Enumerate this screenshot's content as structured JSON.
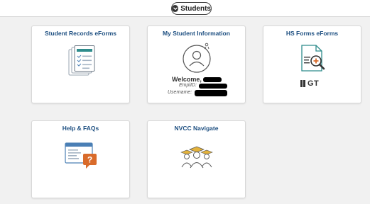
{
  "nav": {
    "current": "Students"
  },
  "tiles": [
    {
      "label": "Student Records eForms",
      "icon": "clipboard-checklist-icon"
    },
    {
      "label": "My Student Information",
      "icon": "student-avatar-icon",
      "welcome_label": "Welcome,",
      "emplid_label": "EmplID:",
      "username_label": "Username:"
    },
    {
      "label": "HS Forms eForms",
      "icon": "document-search-icon",
      "logo_text": "GT"
    },
    {
      "label": "Help & FAQs",
      "icon": "help-screen-icon"
    },
    {
      "label": "NVCC Navigate",
      "icon": "graduates-icon"
    }
  ],
  "colors": {
    "title": "#1c4e80",
    "accent_orange": "#d96b2b",
    "accent_teal": "#2e8c8c",
    "icon_blue": "#4a7fb5"
  }
}
